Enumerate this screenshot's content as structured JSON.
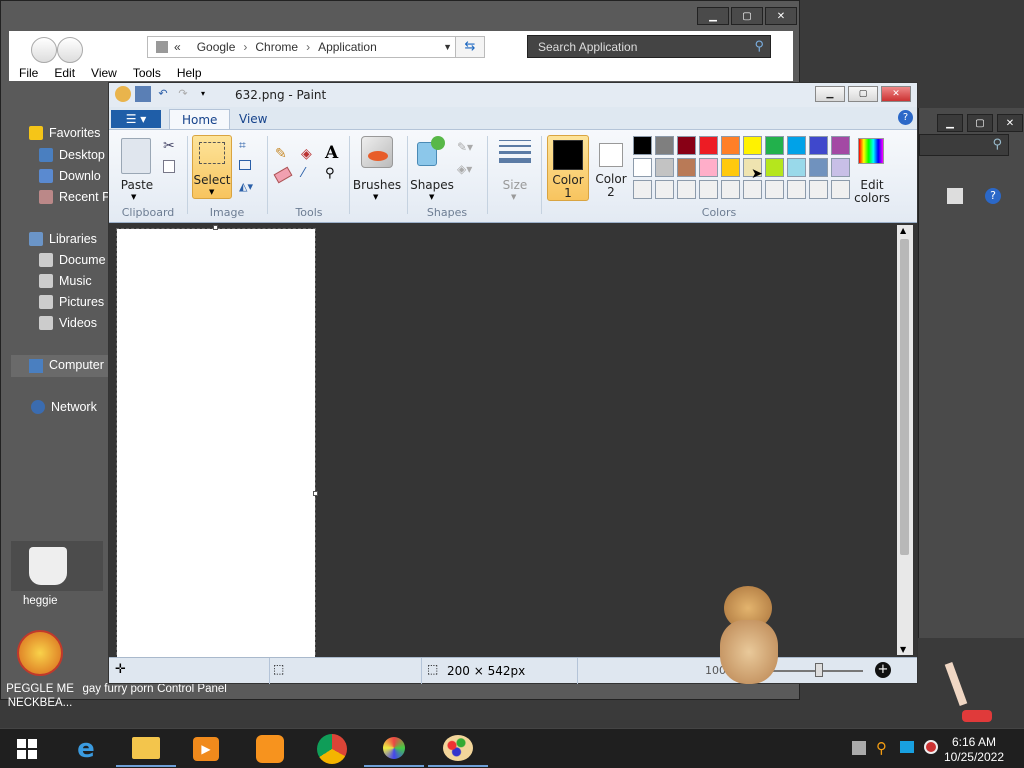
{
  "explorer": {
    "address": [
      "Google",
      "Chrome",
      "Application"
    ],
    "address_prefix": "«",
    "search_placeholder": "Search Application",
    "menu": [
      "File",
      "Edit",
      "View",
      "Tools",
      "Help"
    ],
    "nav": {
      "favorites": "Favorites",
      "desktop": "Desktop",
      "downloads": "Downlo",
      "recent": "Recent P",
      "libraries": "Libraries",
      "documents": "Docume",
      "music": "Music",
      "pictures": "Pictures",
      "videos": "Videos",
      "computer": "Computer",
      "network": "Network"
    }
  },
  "desktop": {
    "peggle_tile_label": "heggie",
    "icons": [
      {
        "label": "PEGGLE ME NECKBEA..."
      },
      {
        "label": "gay furry porn"
      },
      {
        "label": "Control Panel"
      }
    ]
  },
  "paint": {
    "title": "632.png - Paint",
    "tabs": {
      "file": "☰ ▾",
      "home": "Home",
      "view": "View"
    },
    "groups": {
      "clipboard": "Clipboard",
      "image": "Image",
      "tools": "Tools",
      "shapes": "Shapes",
      "colors": "Colors"
    },
    "buttons": {
      "paste": "Paste",
      "select": "Select",
      "brushes": "Brushes",
      "shapes": "Shapes",
      "size": "Size",
      "color1": "Color 1",
      "color2": "Color 2",
      "edit_colors": "Edit colors"
    },
    "color1": "#000000",
    "color2": "#ffffff",
    "palette_row1": [
      "#000000",
      "#7f7f7f",
      "#880015",
      "#ed1c24",
      "#ff7f27",
      "#fff200",
      "#22b14c",
      "#00a2e8",
      "#3f48cc",
      "#a349a4"
    ],
    "palette_row2": [
      "#ffffff",
      "#c3c3c3",
      "#b97a57",
      "#ffaec9",
      "#ffc90e",
      "#efe4b0",
      "#b5e61d",
      "#99d9ea",
      "#7092be",
      "#c8bfe7"
    ],
    "palette_row3": [
      "#f0f0f0",
      "#f0f0f0",
      "#f0f0f0",
      "#f0f0f0",
      "#f0f0f0",
      "#f0f0f0",
      "#f0f0f0",
      "#f0f0f0",
      "#f0f0f0",
      "#f0f0f0"
    ],
    "status": {
      "dimensions": "200 × 542px",
      "zoom": "100%"
    }
  },
  "taskbar": {
    "time": "6:16 AM",
    "date": "10/25/2022",
    "apps": [
      "start-button",
      "internet-explorer",
      "file-explorer",
      "media-player",
      "uc-browser",
      "chrome",
      "game",
      "paint"
    ]
  }
}
